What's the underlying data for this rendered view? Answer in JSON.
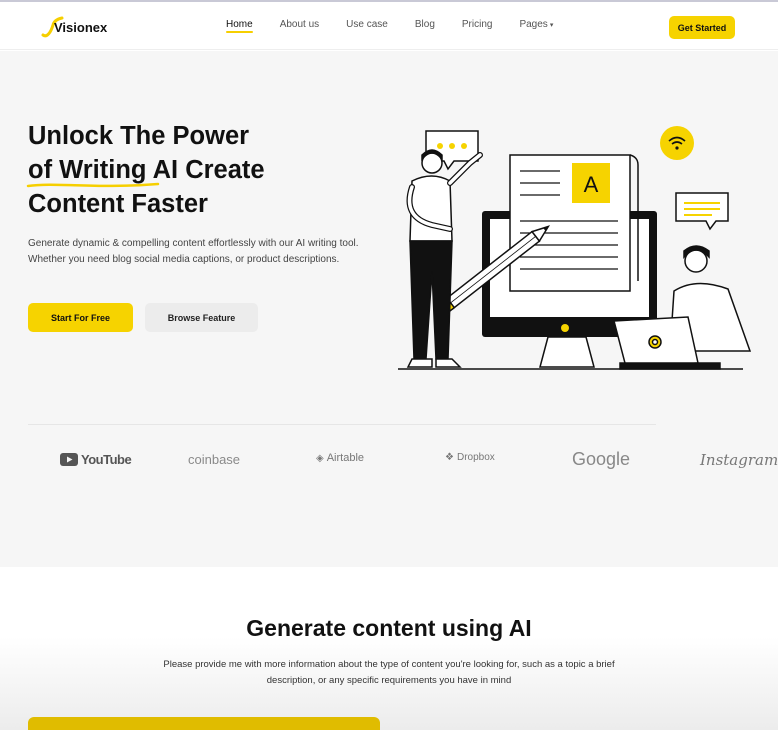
{
  "nav": {
    "logo": "Visionex",
    "links": [
      {
        "label": "Home",
        "active": true
      },
      {
        "label": "About us",
        "active": false
      },
      {
        "label": "Use case",
        "active": false
      },
      {
        "label": "Blog",
        "active": false
      },
      {
        "label": "Pricing",
        "active": false
      },
      {
        "label": "Pages",
        "active": false
      }
    ],
    "cta": "Get Started"
  },
  "hero": {
    "title_line1": "Unlock The Power",
    "title_line2_highlight": "of Writing",
    "title_line2_rest": " AI Create",
    "title_line3": "Content Faster",
    "description": "Generate dynamic & compelling content effortlessly with our AI writing tool. Whether you need blog social media captions, or product descriptions.",
    "primary_button": "Start For Free",
    "secondary_button": "Browse Feature",
    "illustration_letter": "A"
  },
  "brands": [
    "YouTube",
    "coinbase",
    "Airtable",
    "Dropbox",
    "Google",
    "Instagram"
  ],
  "section2": {
    "title": "Generate content using AI",
    "description": "Please provide me with more information about the type of content you're looking for, such as a topic a brief description, or any specific requirements you have in mind"
  },
  "colors": {
    "accent": "#f6d300",
    "hero_bg": "#f6f6f6",
    "text_dark": "#111111"
  }
}
